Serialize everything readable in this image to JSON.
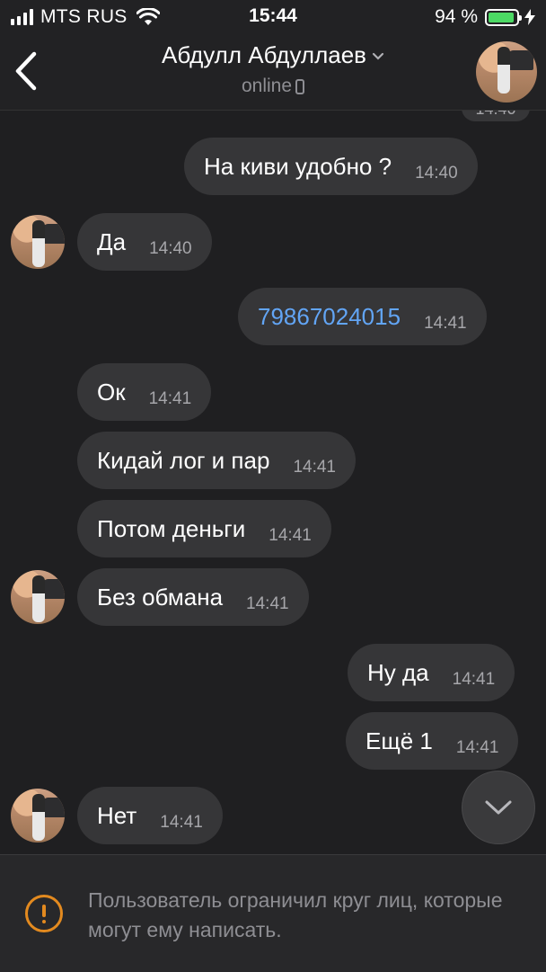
{
  "status_bar": {
    "carrier": "MTS RUS",
    "time": "15:44",
    "battery": "94 %",
    "battery_color": "#4cd964"
  },
  "header": {
    "contact_name": "Абдулл Абдуллаев",
    "status": "online",
    "icons": [
      "back-chevron-icon",
      "chevron-down-icon",
      "phone-icon",
      "avatar"
    ]
  },
  "messages": [
    {
      "side": "out",
      "text": "На киви удобно ?",
      "time": "14:40"
    },
    {
      "side": "in",
      "text": "Да",
      "time": "14:40",
      "avatar": true
    },
    {
      "side": "out",
      "text": "79867024015",
      "time": "14:41",
      "link": true
    },
    {
      "side": "in",
      "text": "Ок",
      "time": "14:41"
    },
    {
      "side": "in",
      "text": "Кидай лог и пар",
      "time": "14:41"
    },
    {
      "side": "in",
      "text": "Потом деньги",
      "time": "14:41"
    },
    {
      "side": "in",
      "text": "Без обмана",
      "time": "14:41",
      "avatar": true
    },
    {
      "side": "out",
      "text": "Ну да",
      "time": "14:41"
    },
    {
      "side": "out",
      "text": "Ещё 1",
      "time": "14:41"
    },
    {
      "side": "in",
      "text": "Нет",
      "time": "14:41",
      "avatar": true
    }
  ],
  "footer": {
    "notice": "Пользователь ограничил круг лиц, которые могут ему написать.",
    "accent_color": "#e38a1f"
  },
  "colors": {
    "background": "#1f1f21",
    "bubble": "#363638",
    "link": "#62a5f5"
  }
}
